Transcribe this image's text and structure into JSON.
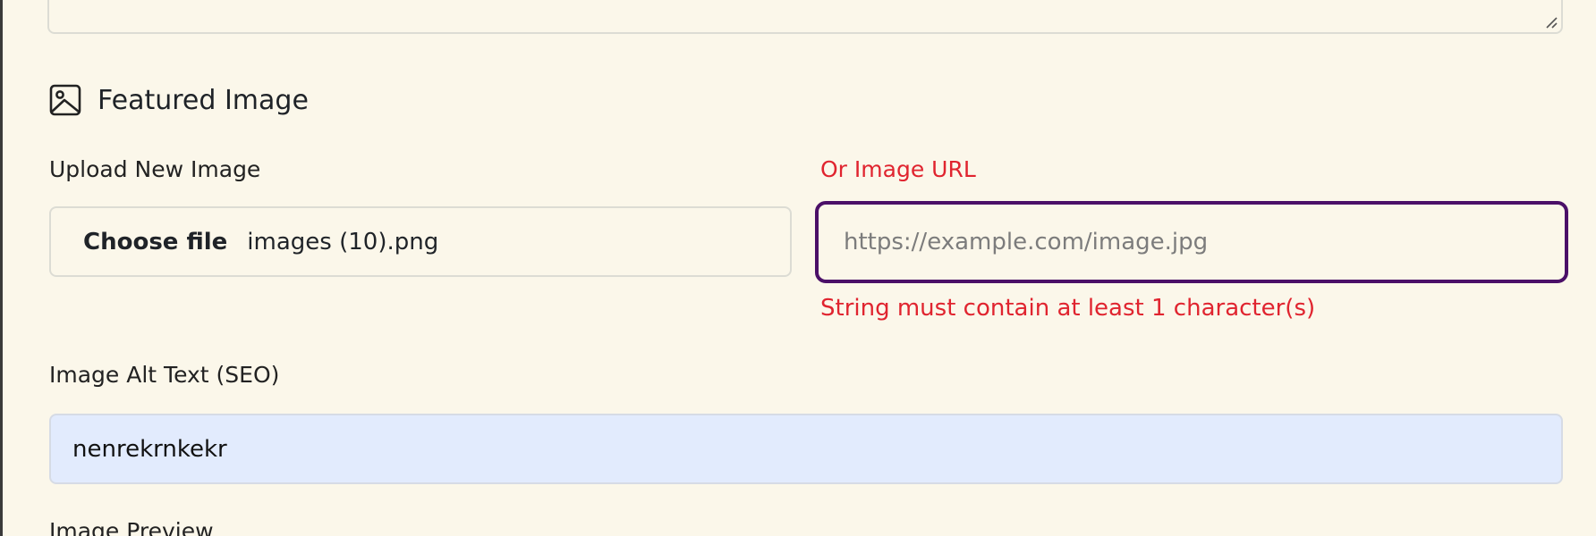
{
  "section": {
    "title": "Featured Image",
    "icon": "image-icon"
  },
  "upload": {
    "label": "Upload New Image",
    "button_label": "Choose file",
    "file_name": "images (10).png"
  },
  "image_url": {
    "label": "Or Image URL",
    "value": "",
    "placeholder": "https://example.com/image.jpg",
    "error": "String must contain at least 1 character(s)"
  },
  "alt_text": {
    "label": "Image Alt Text (SEO)",
    "value": "nenrekrnkekr"
  },
  "preview": {
    "label": "Image Preview"
  },
  "colors": {
    "background": "#fbf7ea",
    "error": "#e0242f",
    "focus_border": "#4b1068",
    "autofill_bg": "#e2ebfd"
  }
}
